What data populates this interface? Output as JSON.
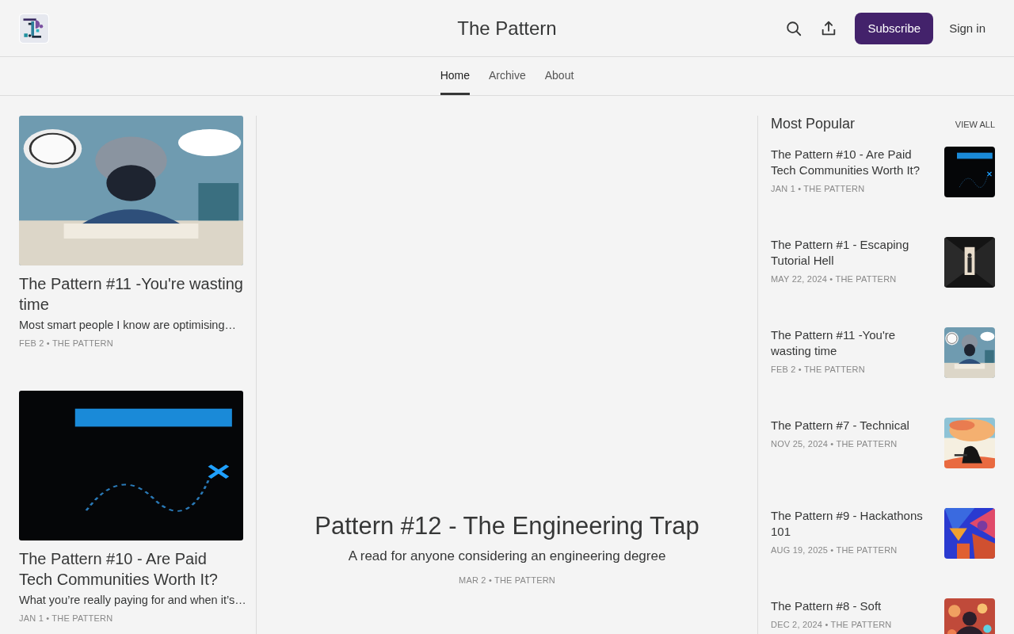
{
  "header": {
    "publication": "The Pattern",
    "subscribe": "Subscribe",
    "sign_in": "Sign in"
  },
  "nav": [
    {
      "label": "Home",
      "selected": true
    },
    {
      "label": "Archive",
      "selected": false
    },
    {
      "label": "About",
      "selected": false
    }
  ],
  "left_posts": [
    {
      "title": "The Pattern #11 -You're wasting time",
      "subtitle": "Most smart people I know are optimising…",
      "meta": "FEB 2 • THE PATTERN"
    },
    {
      "title": "The Pattern #10 - Are Paid Tech Communities Worth It?",
      "subtitle": "What you’re really paying for and when it’s…",
      "meta": "JAN 1 • THE PATTERN"
    }
  ],
  "featured": {
    "title": "Pattern #12 - The Engineering Trap",
    "subtitle": "A read for anyone considering an engineering degree",
    "meta": "MAR 2 • THE PATTERN"
  },
  "most_popular": {
    "heading": "Most Popular",
    "view_all": "VIEW ALL",
    "items": [
      {
        "title": "The Pattern #10 - Are Paid Tech Communities Worth It?",
        "meta": "JAN 1 • THE PATTERN"
      },
      {
        "title": "The Pattern #1 - Escaping Tutorial Hell",
        "meta": "MAY 22, 2024 • THE PATTERN"
      },
      {
        "title": "The Pattern #11 -You're wasting time",
        "meta": "FEB 2 • THE PATTERN"
      },
      {
        "title": "The Pattern #7 - Technical",
        "meta": "NOV 25, 2024 • THE PATTERN"
      },
      {
        "title": "The Pattern #9 - Hackathons 101",
        "meta": "AUG 19, 2025 • THE PATTERN"
      },
      {
        "title": "The Pattern #8 - Soft",
        "meta": "DEC 2, 2024 • THE PATTERN"
      }
    ]
  }
}
